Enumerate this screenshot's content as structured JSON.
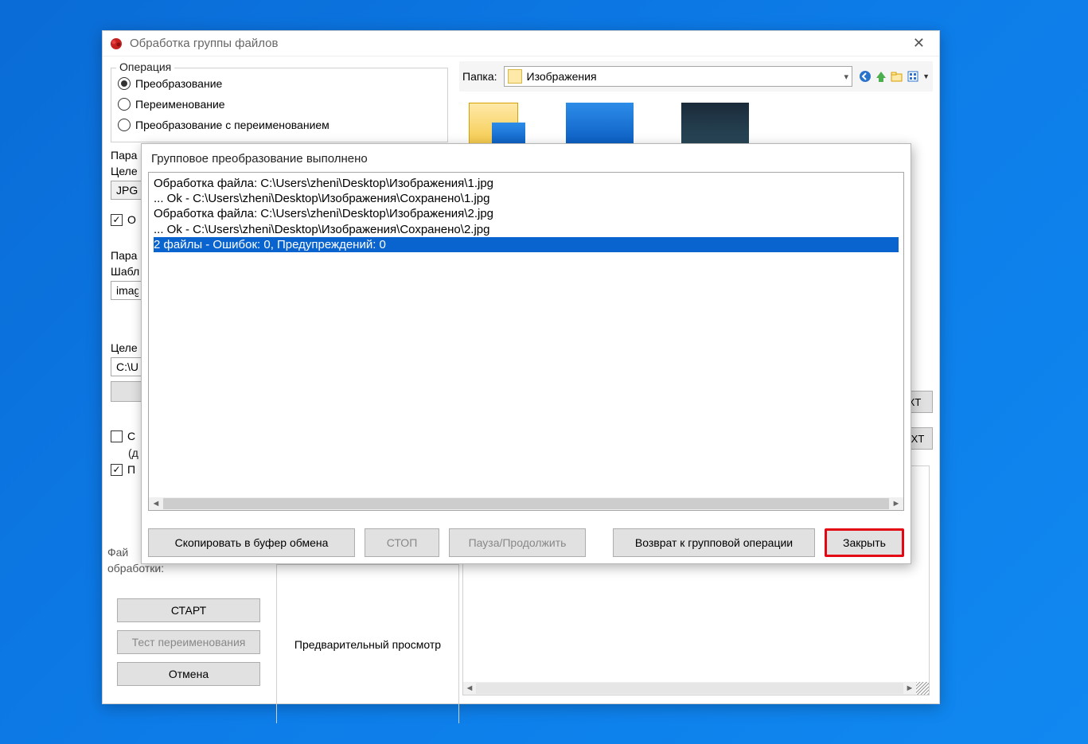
{
  "window": {
    "title": "Обработка группы файлов"
  },
  "operation": {
    "legend": "Операция",
    "radio1": "Преобразование",
    "radio2": "Переименование",
    "radio3": "Преобразование с переименованием",
    "selected": 0
  },
  "params_group_label": "Пара",
  "target_format_label": "Целе",
  "target_format_value": "JPG",
  "checkbox_partial1": "О",
  "params_group2_label": "Пара",
  "template_label": "Шабл",
  "template_value": "imag",
  "target_folder_label": "Целе",
  "target_folder_value": "C:\\U",
  "checkbox_partial2": "С",
  "checkbox_partial2b": "(д",
  "checkbox_partial3": "П",
  "file_row_label": "Фай",
  "processing_label": "обработки:",
  "buttons": {
    "start": "СТАРТ",
    "test_rename": "Тест переименования",
    "cancel": "Отмена"
  },
  "preview_label": "Предварительный просмотр",
  "folder_row": {
    "label": "Папка:",
    "value": "Изображения"
  },
  "txt_button": "XT",
  "txt_button_full": "TXT",
  "modal": {
    "title": "Групповое преобразование выполнено",
    "log": [
      "Обработка файла: C:\\Users\\zheni\\Desktop\\Изображения\\1.jpg",
      "... Ok - C:\\Users\\zheni\\Desktop\\Изображения\\Сохранено\\1.jpg",
      "",
      "Обработка файла: C:\\Users\\zheni\\Desktop\\Изображения\\2.jpg",
      "... Ok - C:\\Users\\zheni\\Desktop\\Изображения\\Сохранено\\2.jpg",
      ""
    ],
    "summary": "2 файлы - Ошибок: 0, Предупреждений: 0",
    "btn_copy": "Скопировать в буфер обмена",
    "btn_stop": "СТОП",
    "btn_pause": "Пауза/Продолжить",
    "btn_return": "Возврат к групповой операции",
    "btn_close": "Закрыть"
  }
}
